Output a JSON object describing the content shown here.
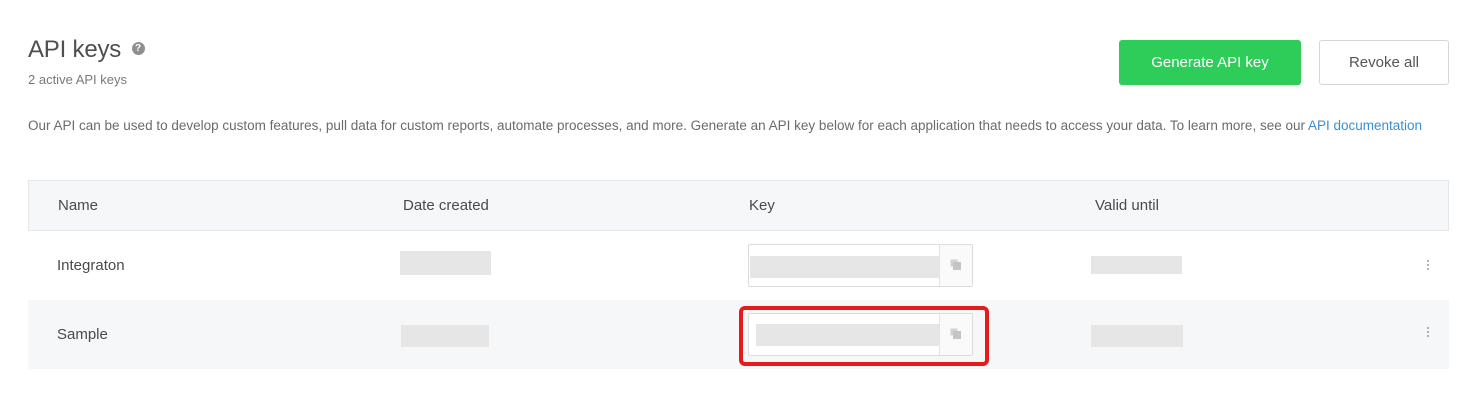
{
  "header": {
    "title": "API keys",
    "help_icon": "question-circle-icon",
    "subtitle": "2 active API keys",
    "generate_label": "Generate API key",
    "revoke_label": "Revoke all"
  },
  "description": {
    "text": "Our API can be used to develop custom features, pull data for custom reports, automate processes, and more. Generate an API key below for each application that needs to access your data. To learn more, see our ",
    "link_text": "API documentation"
  },
  "table": {
    "columns": [
      "Name",
      "Date created",
      "Key",
      "Valid until"
    ],
    "rows": [
      {
        "name": "Integraton"
      },
      {
        "name": "Sample"
      }
    ]
  },
  "colors": {
    "accent_green": "#2ecc59",
    "link_blue": "#3b8fd6",
    "highlight_red": "#e31b1b"
  }
}
